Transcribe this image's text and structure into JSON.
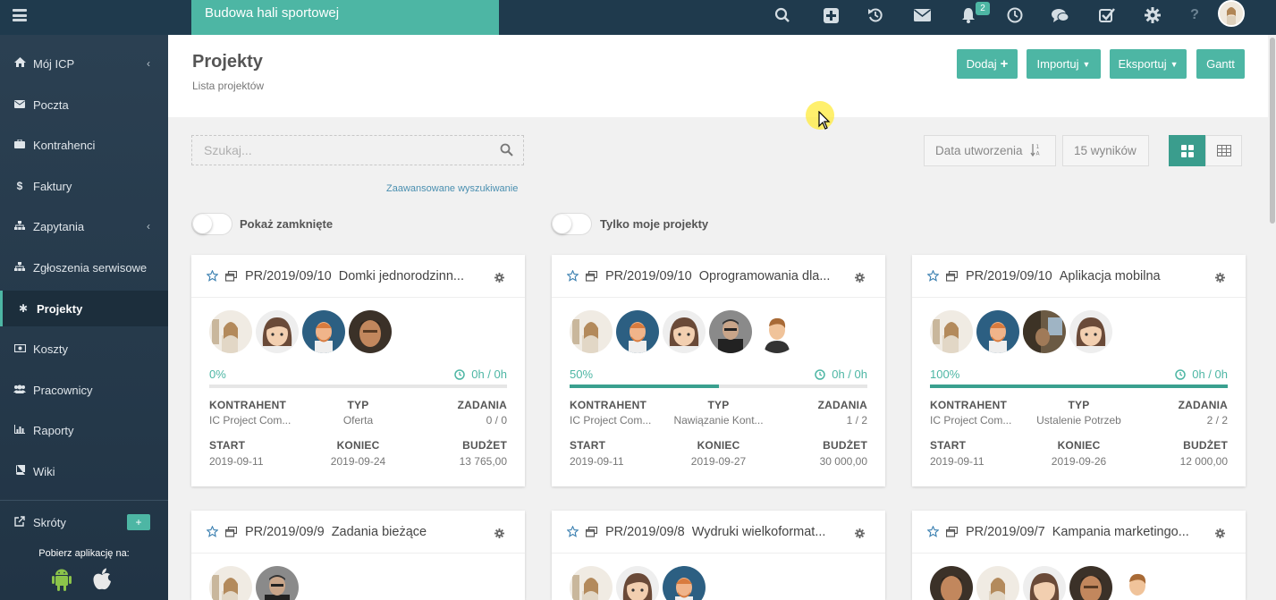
{
  "topbar": {
    "tab_title": "Budowa hali sportowej",
    "notification_count": "2",
    "help": "?",
    "colors": {
      "bar": "#1f3a4d",
      "accent": "#4db6a4"
    }
  },
  "sidebar": {
    "items": [
      {
        "label": "Mój ICP",
        "icon": "home-icon",
        "chev": "‹"
      },
      {
        "label": "Poczta",
        "icon": "envelope-icon"
      },
      {
        "label": "Kontrahenci",
        "icon": "briefcase-icon"
      },
      {
        "label": "Faktury",
        "icon": "dollar-icon"
      },
      {
        "label": "Zapytania",
        "icon": "sitemap-icon",
        "chev": "‹"
      },
      {
        "label": "Zgłoszenia serwisowe",
        "icon": "sitemap-icon"
      },
      {
        "label": "Projekty",
        "icon": "asterisk-icon"
      },
      {
        "label": "Koszty",
        "icon": "money-icon"
      },
      {
        "label": "Pracownicy",
        "icon": "users-icon"
      },
      {
        "label": "Raporty",
        "icon": "bar-chart-icon"
      },
      {
        "label": "Wiki",
        "icon": "book-icon"
      }
    ],
    "shortcuts": "Skróty",
    "shortcuts_plus": "+",
    "apps_label": "Pobierz aplikację na:"
  },
  "header": {
    "title": "Projekty",
    "subtitle": "Lista projektów",
    "buttons": {
      "add": "Dodaj",
      "add_plus": "+",
      "import": "Importuj",
      "export": "Eksportuj",
      "gantt": "Gantt"
    }
  },
  "filters": {
    "search_placeholder": "Szukaj...",
    "advanced": "Zaawansowane wyszukiwanie",
    "show_closed": "Pokaż zamknięte",
    "only_mine": "Tylko moje projekty",
    "sort": "Data utworzenia",
    "results": "15 wyników"
  },
  "labels": {
    "client": "KONTRAHENT",
    "type": "TYP",
    "tasks": "ZADANIA",
    "start": "START",
    "end": "KONIEC",
    "budget": "BUDŻET"
  },
  "projects": [
    {
      "number": "PR/2019/09/10",
      "title": "Domki jednorodzinn...",
      "progress": 0,
      "progress_label": "0%",
      "hours": "0h / 0h",
      "client": "IC Project Com...",
      "type": "Oferta",
      "tasks": "0 / 0",
      "start": "2019-09-11",
      "end": "2019-09-24",
      "budget": "13 765,00"
    },
    {
      "number": "PR/2019/09/10",
      "title": "Oprogramowania dla...",
      "progress": 50,
      "progress_label": "50%",
      "hours": "0h / 0h",
      "client": "IC Project Com...",
      "type": "Nawiązanie Kont...",
      "tasks": "1 / 2",
      "start": "2019-09-11",
      "end": "2019-09-27",
      "budget": "30 000,00"
    },
    {
      "number": "PR/2019/09/10",
      "title": "Aplikacja mobilna",
      "progress": 100,
      "progress_label": "100%",
      "hours": "0h / 0h",
      "client": "IC Project Com...",
      "type": "Ustalenie Potrzeb",
      "tasks": "2 / 2",
      "start": "2019-09-11",
      "end": "2019-09-26",
      "budget": "12 000,00"
    },
    {
      "number": "PR/2019/09/9",
      "title": "Zadania bieżące"
    },
    {
      "number": "PR/2019/09/8",
      "title": "Wydruki wielkoformat..."
    },
    {
      "number": "PR/2019/09/7",
      "title": "Kampania marketingo..."
    }
  ]
}
